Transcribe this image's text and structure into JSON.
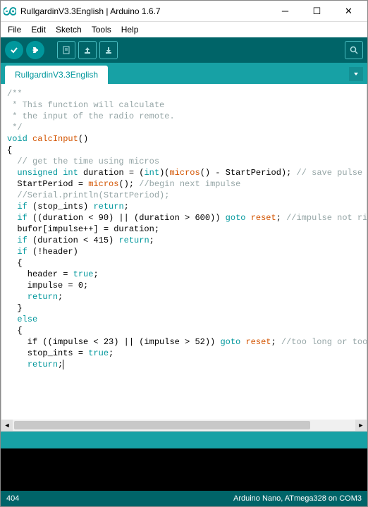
{
  "window": {
    "title": "RullgardinV3.3English | Arduino 1.6.7"
  },
  "menu": {
    "file": "File",
    "edit": "Edit",
    "sketch": "Sketch",
    "tools": "Tools",
    "help": "Help"
  },
  "tab": {
    "active": "RullgardinV3.3English"
  },
  "status": {
    "left": "404",
    "right": "Arduino Nano, ATmega328 on COM3"
  },
  "code": {
    "c01": "/**",
    "c02": " * This function will calculate",
    "c03": " * the input of the radio remote.",
    "c04": " */",
    "k_void": "void",
    "fn_calcInput": "calcInput",
    "paren_empty": "()",
    "brace_open": "{",
    "c05": "  // get the time using micros",
    "k_unsigned": "unsigned",
    "k_int": "int",
    "l_dur": " duration = (",
    "cast_int": "int",
    "l_after_cast": ")(",
    "fn_micros": "micros",
    "l_micros_end": "() - StartPeriod); ",
    "c06": "// save pulse ",
    "l_sp": "  StartPeriod = ",
    "l_sp_end": "(); ",
    "c07": "//begin next impulse",
    "c08": "  //Serial.println(StartPeriod);",
    "k_if": "if",
    "l_if_stop": " (stop_ints) ",
    "k_return": "return",
    "semicolon": ";",
    "l_if_dur1": " ((duration < 90) || (duration > 600)) ",
    "k_goto": "goto",
    "sp": " ",
    "lb_reset": "reset",
    "c09": "//impulse not ri",
    "l_bufor": "  bufor[impulse++] = duration;",
    "l_if_dur2": " (duration < 415) ",
    "l_if_header": " (!header)",
    "l_brace2": "  {",
    "l_header_true": "    header = ",
    "v_true": "true",
    "l_impulse0": "    impulse = 0;",
    "l_return_i": "    ",
    "l_brace2c": "  }",
    "k_else": "else",
    "l_if_imp": "    if ((impulse < 23) || (impulse > 52)) ",
    "c10": "//too long or too",
    "l_stop_true": "    stop_ints = ",
    "l_brace3": "    "
  }
}
